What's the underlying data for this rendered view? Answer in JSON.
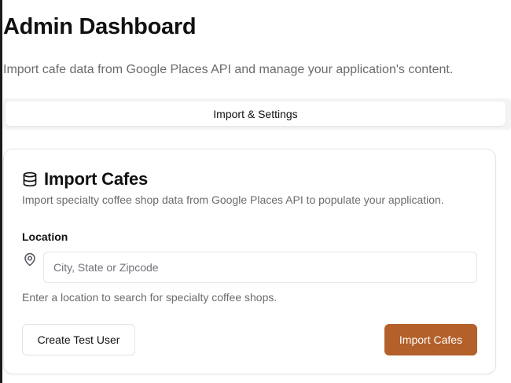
{
  "header": {
    "title": "Admin Dashboard",
    "subtitle": "Import cafe data from Google Places API and manage your application's content."
  },
  "tabs": [
    {
      "label": "Import & Settings",
      "active": true
    }
  ],
  "import_card": {
    "icon": "database-icon",
    "title": "Import Cafes",
    "description": "Import specialty coffee shop data from Google Places API to populate your application.",
    "location_label": "Location",
    "location_icon": "map-pin-icon",
    "location_value": "",
    "location_placeholder": "City, State or Zipcode",
    "location_help": "Enter a location to search for specialty coffee shops.",
    "secondary_button": "Create Test User",
    "primary_button": "Import Cafes"
  },
  "colors": {
    "accent": "#b4602a",
    "border": "#e4e4e7",
    "muted_text": "#6b6b6b"
  }
}
